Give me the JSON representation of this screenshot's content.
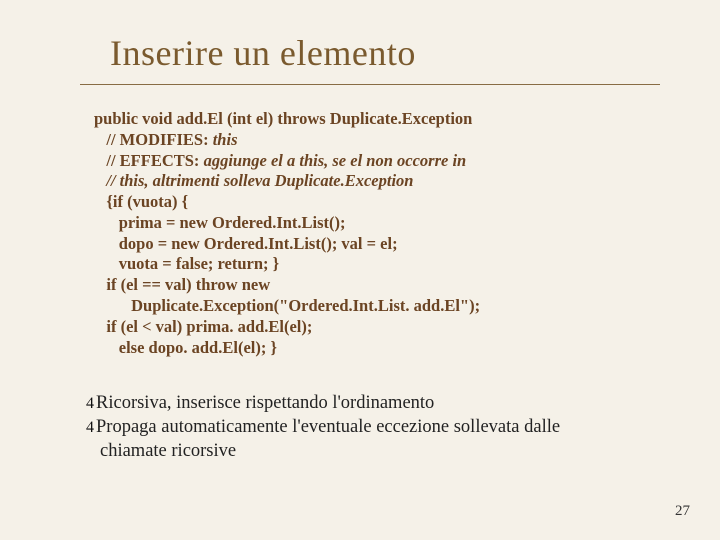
{
  "title": "Inserire un elemento",
  "code": {
    "l1a": "public void add.El (int el) throws Duplicate.Exception",
    "l2a": "   // MODIFIES: ",
    "l2b": "this",
    "l3a": "   // EFFECTS: ",
    "l3b": "aggiunge el a this, se el non occorre in",
    "l4a": "   // this, altrimenti solleva Duplicate.Exception",
    "l5": "   {if (vuota) {",
    "l6": "      prima = new Ordered.Int.List();",
    "l7": "      dopo = new Ordered.Int.List(); val = el;",
    "l8": "      vuota = false; return; }",
    "l9": "   if (el == val) throw new",
    "l10a": "         Duplicate.Exception(",
    "l10b": "\"Ordered.Int.List. add.El\");",
    "l11": "   if (el < val) prima. add.El(el);",
    "l12": "      else dopo. add.El(el); }"
  },
  "bullets": {
    "marker": "4",
    "b1": "Ricorsiva, inserisce rispettando l'ordinamento",
    "b2": "Propaga automaticamente l'eventuale eccezione sollevata dalle",
    "b2cont": "chiamate ricorsive"
  },
  "page": "27"
}
